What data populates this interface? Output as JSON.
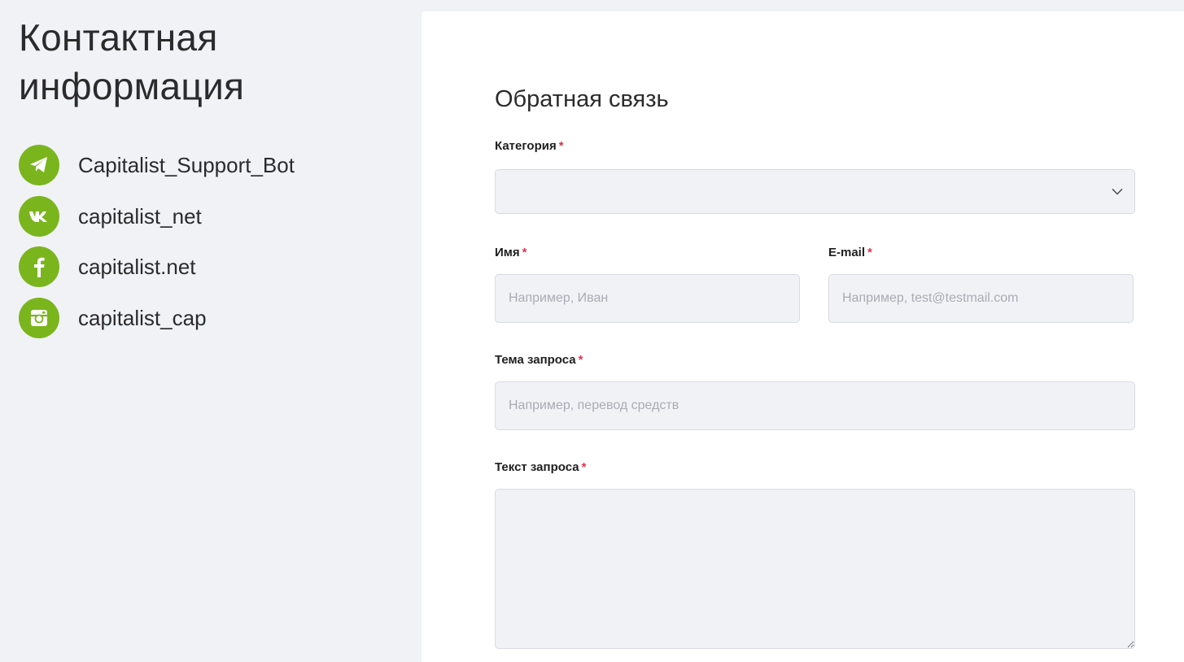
{
  "contacts": {
    "title": "Контактная информация",
    "items": [
      {
        "label": "Capitalist_Support_Bot",
        "icon": "telegram-icon"
      },
      {
        "label": "capitalist_net",
        "icon": "vk-icon"
      },
      {
        "label": "capitalist.net",
        "icon": "facebook-icon"
      },
      {
        "label": "capitalist_cap",
        "icon": "instagram-icon"
      }
    ],
    "icon_color": "#7ab51d"
  },
  "form": {
    "title": "Обратная связь",
    "required_mark": "*",
    "category": {
      "label": "Категория",
      "value": ""
    },
    "name": {
      "label": "Имя",
      "placeholder": "Например, Иван"
    },
    "email": {
      "label": "E-mail",
      "placeholder": "Например, test@testmail.com"
    },
    "subject": {
      "label": "Тема запроса",
      "placeholder": "Например, перевод средств"
    },
    "message": {
      "label": "Текст запроса",
      "placeholder": ""
    }
  },
  "colors": {
    "background": "#f1f2f6",
    "panel": "#ffffff",
    "accent": "#7ab51d",
    "required": "#e0334b"
  }
}
